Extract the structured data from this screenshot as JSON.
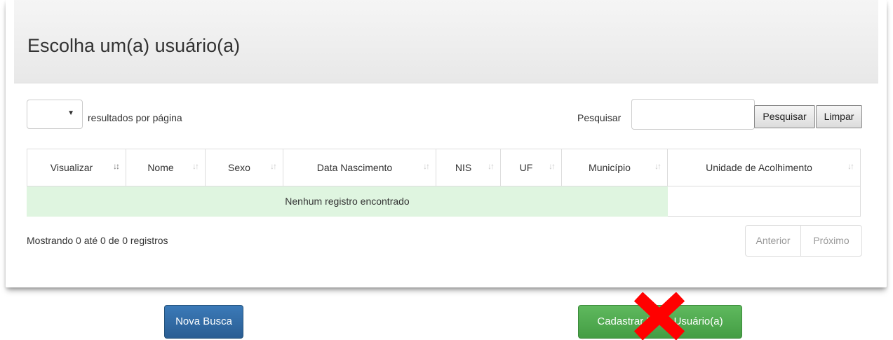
{
  "panel": {
    "title": "Escolha um(a) usuário(a)"
  },
  "controls": {
    "length_selected": "",
    "length_caret": "▼",
    "length_label": "resultados por página",
    "search_label": "Pesquisar",
    "search_value": "",
    "search_button": "Pesquisar",
    "clear_button": "Limpar"
  },
  "table": {
    "columns": [
      {
        "label": "Visualizar",
        "sort": "↓↕"
      },
      {
        "label": "Nome",
        "sort": "↓↑"
      },
      {
        "label": "Sexo",
        "sort": "↓↑"
      },
      {
        "label": "Data Nascimento",
        "sort": "↓↑"
      },
      {
        "label": "NIS",
        "sort": "↓↑"
      },
      {
        "label": "UF",
        "sort": "↓↑"
      },
      {
        "label": "Município",
        "sort": "↓↑"
      },
      {
        "label": "Unidade de Acolhimento",
        "sort": "↓↑"
      }
    ],
    "empty_message": "Nenhum registro encontrado"
  },
  "footer": {
    "info": "Mostrando 0 até 0 de 0 registros",
    "prev": "Anterior",
    "next": "Próximo"
  },
  "actions": {
    "nova_busca": "Nova Busca",
    "cadastrar": "Cadastrar Novo Usuário(a)"
  },
  "colors": {
    "empty_row": "#dff5e0",
    "primary": "#2a5d93",
    "success": "#449d44",
    "x_mark": "#ff0000"
  }
}
